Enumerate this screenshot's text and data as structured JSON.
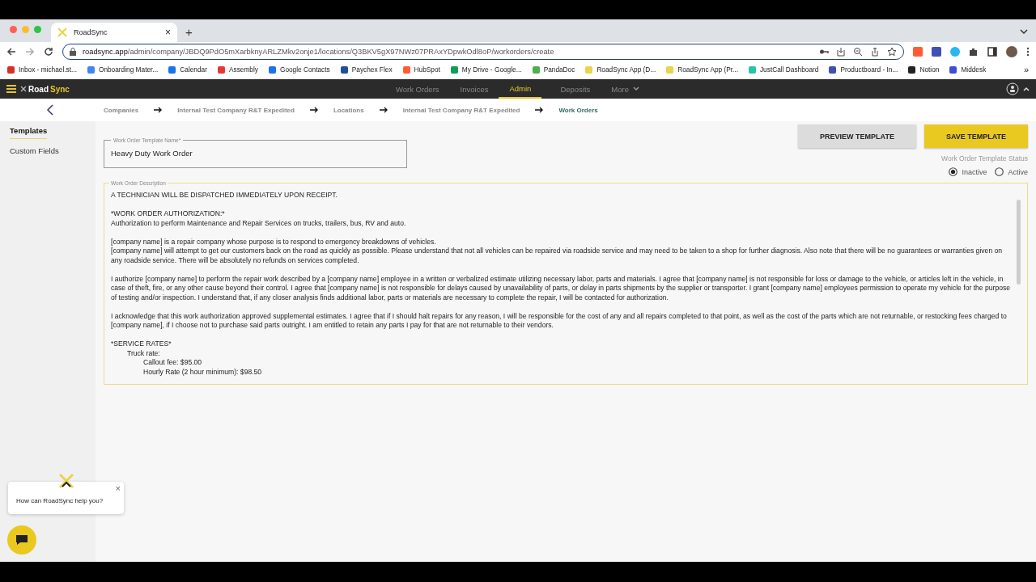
{
  "browser": {
    "tab": {
      "title": "RoadSync",
      "close": "×"
    },
    "new_tab": "+",
    "url_host": "roadsync.app",
    "url_path": "/admin/company/JBDQ9PdO5mXarbknyARLZMkv2onje1/locations/Q3BKV5gX97NWz07PRAxYDpwkOdl8oP/workorders/create",
    "bookmarks": [
      {
        "label": "Inbox - michael.st...",
        "color": "#d93025"
      },
      {
        "label": "Onboarding Mater...",
        "color": "#4285f4"
      },
      {
        "label": "Calendar",
        "color": "#1a73e8"
      },
      {
        "label": "Assembly",
        "color": "#e53935"
      },
      {
        "label": "Google Contacts",
        "color": "#1a73e8"
      },
      {
        "label": "Paychex Flex",
        "color": "#1f4e9c"
      },
      {
        "label": "HubSpot",
        "color": "#ff5c35"
      },
      {
        "label": "My Drive - Google...",
        "color": "#0f9d58"
      },
      {
        "label": "PandaDoc",
        "color": "#4caf50"
      },
      {
        "label": "RoadSync App (D...",
        "color": "#e8d44d"
      },
      {
        "label": "RoadSync App (Pr...",
        "color": "#e8d44d"
      },
      {
        "label": "JustCall Dashboard",
        "color": "#26c6a6"
      },
      {
        "label": "Productboard - In...",
        "color": "#3f51b5"
      },
      {
        "label": "Notion",
        "color": "#222222"
      },
      {
        "label": "Middesk",
        "color": "#3d4fd8"
      }
    ],
    "more_bookmarks": "»"
  },
  "app": {
    "logo_a": "Road",
    "logo_b": "Sync",
    "nav": [
      {
        "label": "Work Orders",
        "selected": false
      },
      {
        "label": "Invoices",
        "selected": false
      },
      {
        "label": "Admin",
        "selected": true
      },
      {
        "label": "Deposits",
        "selected": false
      },
      {
        "label": "More",
        "selected": false,
        "dropdown": true
      }
    ],
    "breadcrumbs": [
      {
        "label": "Companies",
        "current": false
      },
      {
        "label": "Internal Test Company R&T Expedited",
        "current": false
      },
      {
        "label": "Locations",
        "current": false
      },
      {
        "label": "Internal Test Company R&T Expedited",
        "current": false
      },
      {
        "label": "Work Orders",
        "current": true
      }
    ],
    "sidebar": [
      {
        "label": "Templates",
        "selected": true
      },
      {
        "label": "Custom Fields",
        "selected": false
      }
    ],
    "buttons": [
      {
        "label": "PREVIEW TEMPLATE",
        "kind": "secondary"
      },
      {
        "label": "SAVE TEMPLATE",
        "kind": "primary"
      }
    ],
    "name_field": {
      "label": "Work Order Template Name*",
      "value": "Heavy Duty Work Order"
    },
    "status": {
      "label": "Work Order Template Status",
      "options": [
        {
          "label": "Inactive",
          "selected": true
        },
        {
          "label": "Active",
          "selected": false
        }
      ]
    },
    "description": {
      "label": "Work Order Description",
      "blocks": [
        {
          "lines": [
            {
              "text": "A TECHNICIAN WILL BE DISPATCHED IMMEDIATELY UPON RECEIPT."
            }
          ]
        },
        {
          "lines": [
            {
              "text": "*WORK ORDER AUTHORIZATION:*"
            },
            {
              "text": "Authorization to perform Maintenance and Repair Services on trucks, trailers, bus, RV and auto."
            }
          ]
        },
        {
          "lines": [
            {
              "text": "[company name] is a repair company whose purpose is to respond to emergency breakdowns of vehicles."
            },
            {
              "text": "[company name] will attempt to get our customers back on the road as quickly as possible. Please understand that not all vehicles can be repaired via roadside service and may need to be taken to a shop for further diagnosis. Also note that there will be no guarantees or warranties given on any roadside service. There will be absolutely no refunds on services completed."
            }
          ]
        },
        {
          "lines": [
            {
              "text": "I authorize [company name] to perform the repair work described by a [company name] employee in a written or verbalized estimate utilizing necessary labor, parts and materials. I agree that [company name] is not responsible for loss or damage to the vehicle, or articles left in the vehicle, in case of theft, fire, or any other cause beyond their control. I agree that [company name] is not responsible for delays caused by unavailability of parts, or delay in parts shipments by the supplier or transporter. I grant [company name] employees permission to operate my vehicle for the purpose of testing and/or inspection. I understand that, if any closer analysis finds additional labor, parts or materials are necessary to complete the repair, I will be contacted for authorization."
            }
          ]
        },
        {
          "lines": [
            {
              "text": "I acknowledge that this work authorization approved supplemental estimates. I agree that if I should halt repairs for any reason, I will be responsible for the cost of any and all repairs completed to that point, as well as the cost of the parts which are not returnable, or restocking fees charged to [company name], if I choose not to purchase said parts outright. I am entitled to retain any parts I pay for that are not returnable to their vendors."
            }
          ]
        },
        {
          "lines": [
            {
              "text": "*SERVICE RATES*",
              "children": [
                {
                  "text": "Truck rate:",
                  "children": [
                    {
                      "text": "Callout fee: $95.00"
                    },
                    {
                      "text": "Hourly Rate (2 hour minimum): $98.50"
                    }
                  ]
                }
              ]
            }
          ]
        }
      ]
    },
    "chat": {
      "message": "How can RoadSync help you?",
      "close": "×"
    }
  }
}
